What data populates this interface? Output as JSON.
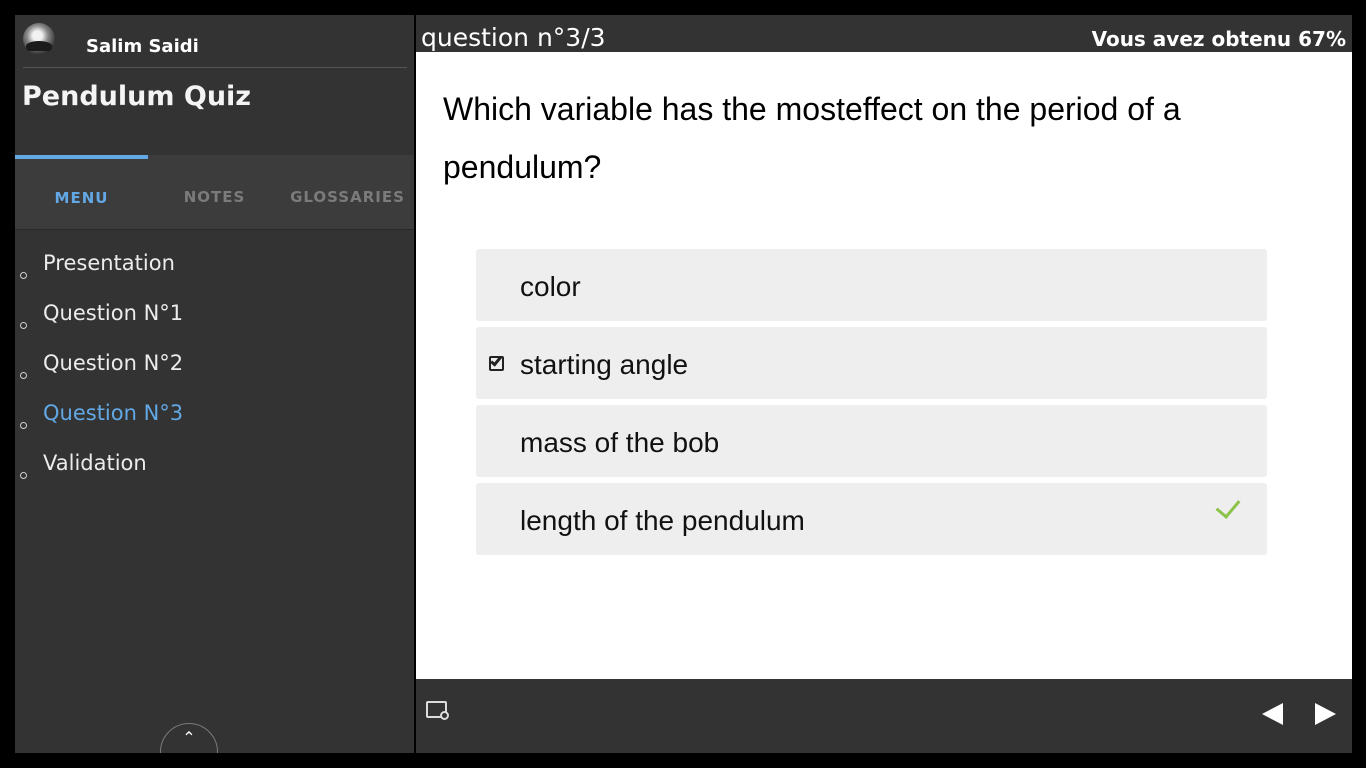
{
  "user": {
    "name": "Salim Saidi"
  },
  "course": {
    "title": "Pendulum Quiz"
  },
  "tabs": [
    {
      "label": "MENU",
      "active": true
    },
    {
      "label": "NOTES",
      "active": false
    },
    {
      "label": "GLOSSARIES",
      "active": false
    }
  ],
  "nav": {
    "items": [
      {
        "label": "Presentation"
      },
      {
        "label": "Question N°1"
      },
      {
        "label": "Question N°2"
      },
      {
        "label": "Question N°3",
        "current": true
      },
      {
        "label": "Validation"
      }
    ]
  },
  "header": {
    "question_counter": "question n°3/3",
    "score": "Vous avez obtenu 67%"
  },
  "question": {
    "text": "Which variable has the mosteffect on the period of a pendulum?",
    "answers": [
      {
        "label": "color",
        "selected": false,
        "correct": false
      },
      {
        "label": "starting angle",
        "selected": true,
        "correct": false
      },
      {
        "label": "mass of the bob",
        "selected": false,
        "correct": false
      },
      {
        "label": "length of the pendulum",
        "selected": false,
        "correct": true
      }
    ]
  },
  "colors": {
    "accent": "#62a8e5",
    "sidebar_bg": "#333333",
    "answer_bg": "#eeeeee",
    "correct_mark": "#8bc34a"
  },
  "icons": {
    "collapse": "double-chevron-up-icon",
    "screen": "screen-icon",
    "prev": "triangle-left-icon",
    "next": "triangle-right-icon"
  }
}
